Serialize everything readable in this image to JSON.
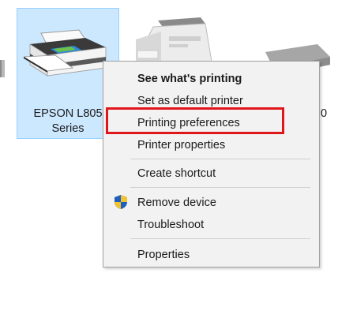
{
  "printer": {
    "name_line1": "EPSON L805",
    "name_line2": "Series"
  },
  "partial_label_right": "0",
  "context_menu": {
    "items": [
      {
        "label": "See what's printing",
        "bold": true
      },
      {
        "label": "Set as default printer"
      },
      {
        "label": "Printing preferences",
        "highlighted": true
      },
      {
        "label": "Printer properties"
      },
      {
        "label": "Create shortcut"
      },
      {
        "label": "Remove device",
        "icon": "uac-shield-icon"
      },
      {
        "label": "Troubleshoot"
      },
      {
        "label": "Properties"
      }
    ]
  },
  "colors": {
    "selection_bg": "#cce8ff",
    "selection_border": "#99d1ff",
    "menu_bg": "#f2f2f2",
    "highlight_border": "#e0161b"
  }
}
